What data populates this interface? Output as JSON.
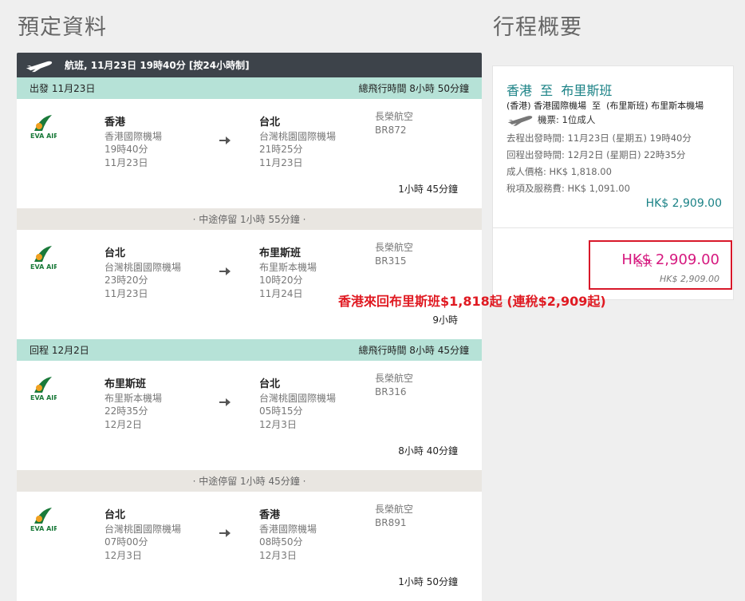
{
  "titles": {
    "left": "預定資料",
    "right": "行程概要"
  },
  "booking": {
    "header": "航班, 11月23日 19時40分 [按24小時制]",
    "outbound": {
      "label": "出發 11月23日",
      "total": "總飛行時間 8小時 50分鐘",
      "segments": [
        {
          "from_city": "香港",
          "from_airport": "香港國際機場",
          "dep_time": "19時40分",
          "dep_date": "11月23日",
          "to_city": "台北",
          "to_airport": "台灣桃園國際機場",
          "arr_time": "21時25分",
          "arr_date": "11月23日",
          "airline": "長榮航空",
          "flight": "BR872",
          "duration": "1小時 45分鐘"
        },
        {
          "from_city": "台北",
          "from_airport": "台灣桃園國際機場",
          "dep_time": "23時20分",
          "dep_date": "11月23日",
          "to_city": "布里斯班",
          "to_airport": "布里斯本機場",
          "arr_time": "10時20分",
          "arr_date": "11月24日",
          "airline": "長榮航空",
          "flight": "BR315",
          "duration": "9小時"
        }
      ],
      "stop": "· 中途停留 1小時 55分鐘 ·"
    },
    "return": {
      "label": "回程 12月2日",
      "total": "總飛行時間 8小時 45分鐘",
      "segments": [
        {
          "from_city": "布里斯班",
          "from_airport": "布里斯本機場",
          "dep_time": "22時35分",
          "dep_date": "12月2日",
          "to_city": "台北",
          "to_airport": "台灣桃園國際機場",
          "arr_time": "05時15分",
          "arr_date": "12月3日",
          "airline": "長榮航空",
          "flight": "BR316",
          "duration": "8小時 40分鐘"
        },
        {
          "from_city": "台北",
          "from_airport": "台灣桃園國際機場",
          "dep_time": "07時00分",
          "dep_date": "12月3日",
          "to_city": "香港",
          "to_airport": "香港國際機場",
          "arr_time": "08時50分",
          "arr_date": "12月3日",
          "airline": "長榮航空",
          "flight": "BR891",
          "duration": "1小時 50分鐘"
        }
      ],
      "stop": "· 中途停留 1小時 45分鐘 ·"
    }
  },
  "summary": {
    "route_title": "香港  至  布里斯班",
    "route_airports": "(香港) 香港國際機場  至  (布里斯班) 布里斯本機場",
    "tickets": "機票: 1位成人",
    "outbound_time": "去程出發時間: 11月23日 (星期五) 19時40分",
    "return_time": "回程出發時間: 12月2日 (星期日) 22時35分",
    "adult_price": "成人價格: HK$ 1,818.00",
    "taxes": "稅項及服務費: HK$ 1,091.00",
    "subtotal": "HK$ 2,909.00",
    "total_label": "合共",
    "total_value": "HK$ 2,909.00",
    "total_sub": "HK$ 2,909.00"
  },
  "promo": "香港來回布里斯班$1,818起 (連稅$2,909起)",
  "colors": {
    "teal_bar": "#b6e2d7",
    "dark_header": "#3d434a",
    "accent_teal": "#1b8286",
    "total_pink": "#d6197f",
    "promo_red": "#e01a22"
  }
}
